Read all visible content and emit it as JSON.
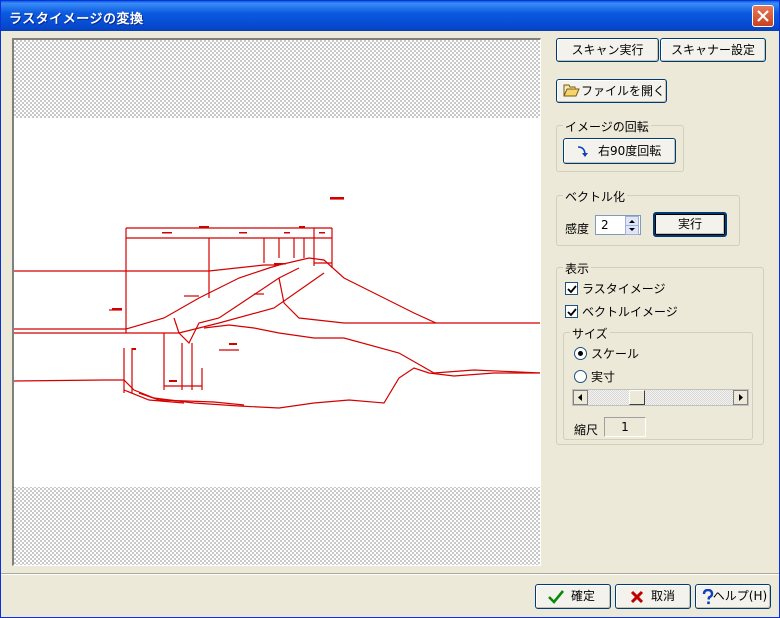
{
  "window": {
    "title": "ラスタイメージの変換"
  },
  "toolbar": {
    "scan_run": "スキャン実行",
    "scanner_settings": "スキャナー設定",
    "open_file": "ファイルを開く"
  },
  "rotation": {
    "legend": "イメージの回転",
    "rotate_right": "右90度回転"
  },
  "vectorize": {
    "legend": "ベクトル化",
    "sensitivity_label": "感度",
    "sensitivity_value": "2",
    "run": "実行"
  },
  "display": {
    "legend": "表示",
    "raster_image": {
      "label": "ラスタイメージ",
      "checked": true
    },
    "vector_image": {
      "label": "ベクトルイメージ",
      "checked": true
    },
    "size": {
      "legend": "サイズ",
      "scale": {
        "label": "スケール",
        "selected": true
      },
      "actual": {
        "label": "実寸",
        "selected": false
      },
      "scale_ratio_label": "縮尺",
      "scale_ratio_value": "1"
    }
  },
  "footer": {
    "ok": "確定",
    "cancel": "取消",
    "help": "ヘルプ(H)"
  },
  "colors": {
    "drawing": "#d40000",
    "title_bar": "#0a5ae0"
  }
}
